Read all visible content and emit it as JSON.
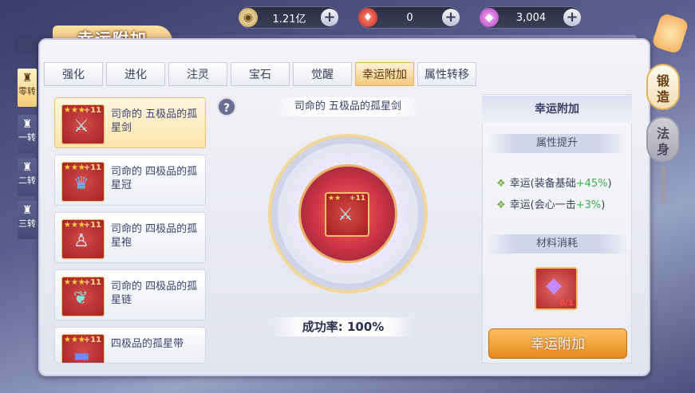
{
  "resources": [
    {
      "icon": "copper-coin-icon",
      "value": "1.21亿"
    },
    {
      "icon": "red-gem-icon",
      "value": "0"
    },
    {
      "icon": "purple-crystal-icon",
      "value": "3,004"
    }
  ],
  "title": "幸运附加",
  "tabs": [
    "强化",
    "进化",
    "注灵",
    "宝石",
    "觉醒",
    "幸运附加",
    "属性转移"
  ],
  "active_tab": 5,
  "side_tabs": [
    "零转",
    "一转",
    "二转",
    "三转"
  ],
  "items": [
    {
      "name": "司命的 五极品的孤星剑",
      "level": "+11",
      "stars": "★★★",
      "glyph": "sword"
    },
    {
      "name": "司命的 四极品的孤星冠",
      "level": "+11",
      "stars": "★★★",
      "glyph": "crown"
    },
    {
      "name": "司命的 四极品的孤星袍",
      "level": "+11",
      "stars": "★★★",
      "glyph": "robe"
    },
    {
      "name": "司命的 四极品的孤星链",
      "level": "+11",
      "stars": "★★★",
      "glyph": "necklace"
    },
    {
      "name": "四极品的孤星带",
      "level": "+11",
      "stars": "★★★",
      "glyph": "belt"
    }
  ],
  "center": {
    "selected_name": "司命的 五极品的孤星剑",
    "item_level": "+11",
    "success_rate": "成功率: 100%"
  },
  "right_panel": {
    "title": "幸运附加",
    "attr_header": "属性提升",
    "attrs": [
      {
        "label": "幸运(装备基础",
        "bonus": "+45%",
        "close": ")"
      },
      {
        "label": "幸运(会心一击",
        "bonus": "+3%",
        "close": ")"
      }
    ],
    "material_header": "材料消耗",
    "material_count": "0/1",
    "action_button": "幸运附加"
  },
  "side_buttons": [
    {
      "label": "锻造"
    },
    {
      "label": "法身"
    }
  ]
}
